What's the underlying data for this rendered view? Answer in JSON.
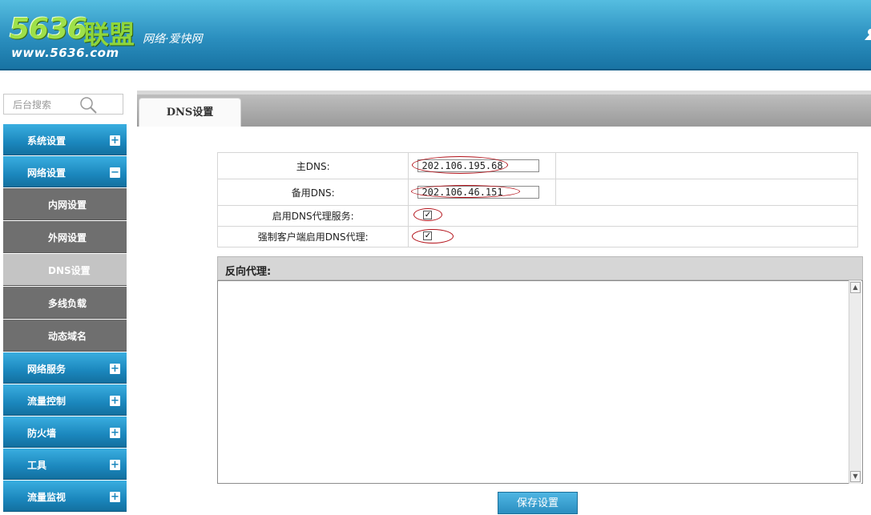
{
  "header": {
    "logo_number": "5636",
    "logo_cn": "联盟",
    "logo_url": "www.5636.com",
    "slogan": "网络·爱快网"
  },
  "search": {
    "placeholder": "后台搜索"
  },
  "sidebar": {
    "items": [
      {
        "label": "系统设置",
        "toggle": "+"
      },
      {
        "label": "网络设置",
        "toggle": "−",
        "expanded": true
      },
      {
        "label": "网络服务",
        "toggle": "+"
      },
      {
        "label": "流量控制",
        "toggle": "+"
      },
      {
        "label": "防火墙",
        "toggle": "+"
      },
      {
        "label": "工具",
        "toggle": "+"
      },
      {
        "label": "流量监视",
        "toggle": "+"
      }
    ],
    "subitems": [
      {
        "label": "内网设置"
      },
      {
        "label": "外网设置"
      },
      {
        "label": "DNS设置",
        "active": true
      },
      {
        "label": "多线负载"
      },
      {
        "label": "动态域名"
      }
    ]
  },
  "tab": {
    "label": "DNS设置"
  },
  "form": {
    "primary_dns_label": "主DNS:",
    "primary_dns_value": "202.106.195.68",
    "secondary_dns_label": "备用DNS:",
    "secondary_dns_value": "202.106.46.151",
    "dns_proxy_label": "启用DNS代理服务:",
    "dns_proxy_checked": true,
    "force_client_label": "强制客户端启用DNS代理:",
    "force_client_checked": true
  },
  "proxy": {
    "title": "反向代理:",
    "value": ""
  },
  "buttons": {
    "save": "保存设置"
  },
  "colors": {
    "header": "#2b8fbf",
    "menu": "#1b87bd",
    "submenu": "#6f6f6f",
    "submenu_active": "#c4c4c4",
    "annotation": "#b3121a"
  },
  "icons": {
    "search": "search-icon",
    "user": "user-icon",
    "plus": "plus-icon",
    "minus": "minus-icon"
  }
}
